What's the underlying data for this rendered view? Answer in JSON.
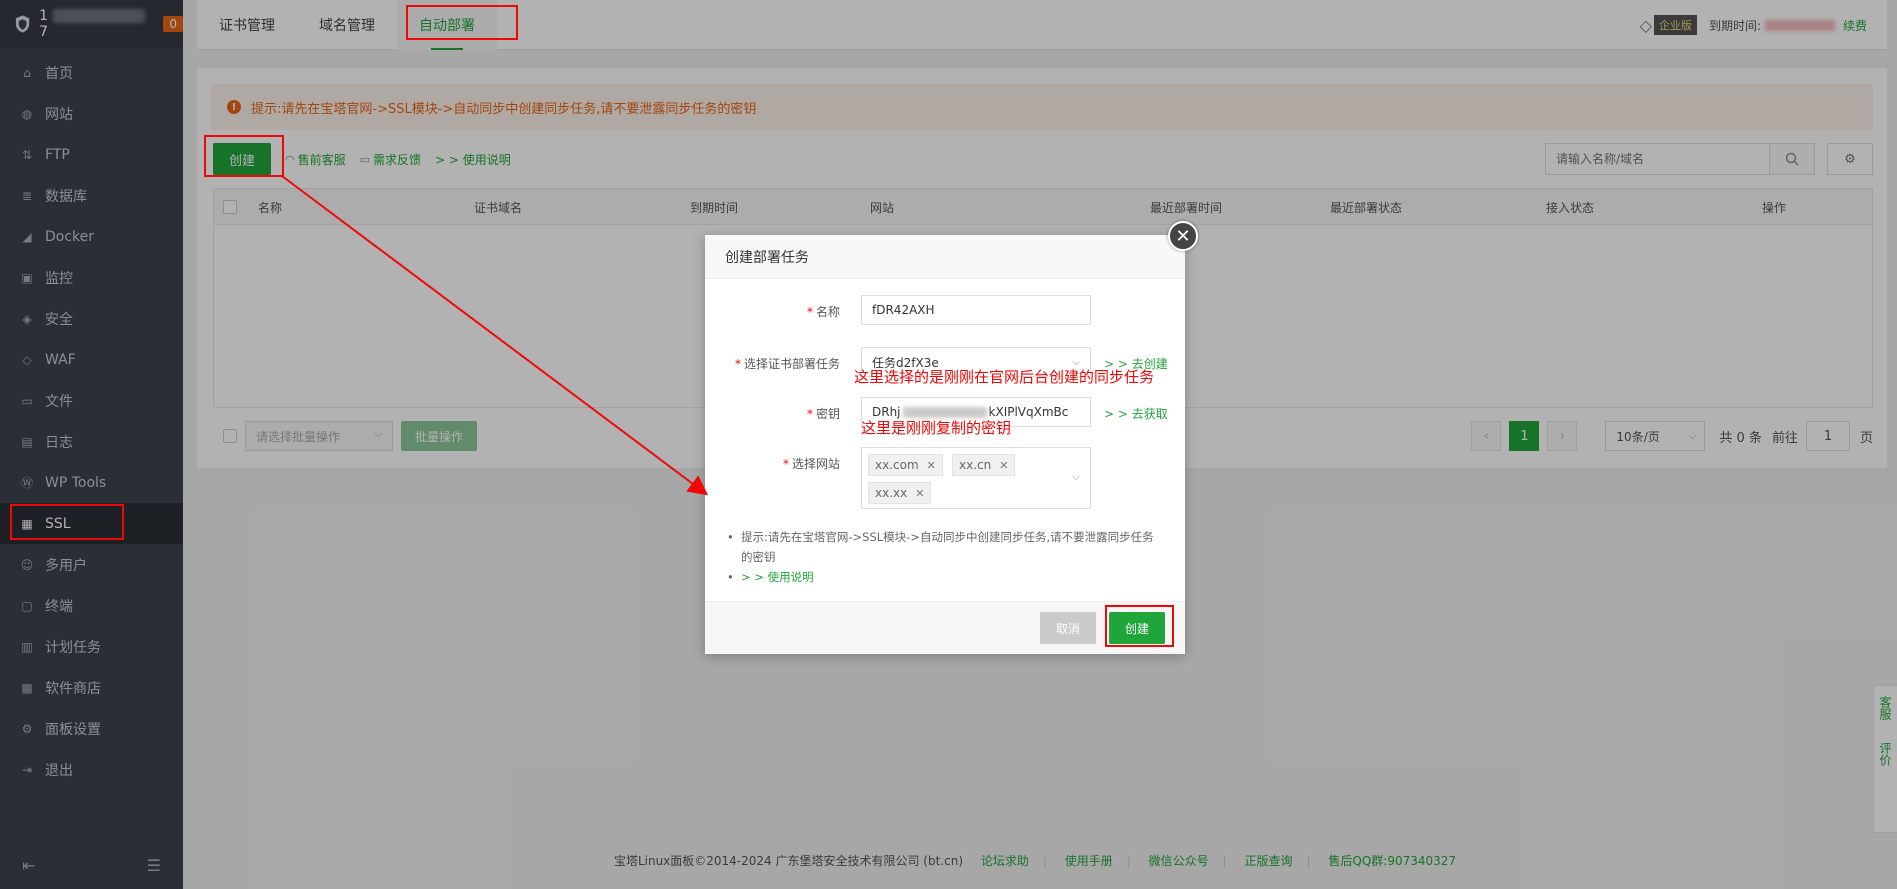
{
  "sidebar": {
    "ip_prefix": "1",
    "ip_suffix": "7",
    "badge": "0",
    "items": [
      {
        "label": "首页",
        "icon": "home-icon",
        "glyph": "⌂"
      },
      {
        "label": "网站",
        "icon": "globe-icon",
        "glyph": "◍"
      },
      {
        "label": "FTP",
        "icon": "ftp-icon",
        "glyph": "⇅"
      },
      {
        "label": "数据库",
        "icon": "database-icon",
        "glyph": "≣"
      },
      {
        "label": "Docker",
        "icon": "docker-icon",
        "glyph": "◢"
      },
      {
        "label": "监控",
        "icon": "monitor-icon",
        "glyph": "▣"
      },
      {
        "label": "安全",
        "icon": "shield-icon",
        "glyph": "◈"
      },
      {
        "label": "WAF",
        "icon": "waf-icon",
        "glyph": "◇"
      },
      {
        "label": "文件",
        "icon": "folder-icon",
        "glyph": "▭"
      },
      {
        "label": "日志",
        "icon": "log-icon",
        "glyph": "▤"
      },
      {
        "label": "WP Tools",
        "icon": "wordpress-icon",
        "glyph": "Ⓦ"
      },
      {
        "label": "SSL",
        "icon": "ssl-icon",
        "glyph": "▦"
      },
      {
        "label": "多用户",
        "icon": "users-icon",
        "glyph": "☺"
      },
      {
        "label": "终端",
        "icon": "terminal-icon",
        "glyph": "▢"
      },
      {
        "label": "计划任务",
        "icon": "calendar-icon",
        "glyph": "▥"
      },
      {
        "label": "软件商店",
        "icon": "apps-icon",
        "glyph": "▩"
      },
      {
        "label": "面板设置",
        "icon": "gear-icon",
        "glyph": "⚙"
      },
      {
        "label": "退出",
        "icon": "logout-icon",
        "glyph": "⇥"
      }
    ]
  },
  "tabs": [
    {
      "label": "证书管理"
    },
    {
      "label": "域名管理"
    },
    {
      "label": "自动部署"
    }
  ],
  "topright": {
    "edition": "企业版",
    "expire_label": "到期时间:",
    "renew": "续费"
  },
  "alert": {
    "text": "提示:请先在宝塔官网->SSL模块->自动同步中创建同步任务,请不要泄露同步任务的密钥"
  },
  "toolbar": {
    "create": "创建",
    "presale": "售前客服",
    "feedback": "需求反馈",
    "usage": "> > 使用说明",
    "search_placeholder": "请输入名称/域名"
  },
  "table": {
    "columns": [
      "名称",
      "证书域名",
      "到期时间",
      "网站",
      "最近部署时间",
      "最近部署状态",
      "接入状态",
      "操作"
    ]
  },
  "batch": {
    "select_placeholder": "请选择批量操作",
    "button": "批量操作"
  },
  "pager": {
    "current": "1",
    "page_size": "10条/页",
    "total": "共 0 条",
    "goto_label": "前往",
    "goto_value": "1",
    "page_suffix": "页"
  },
  "footer": {
    "copyright": "宝塔Linux面板©2014-2024 广东堡塔安全技术有限公司 (bt.cn)",
    "links": [
      "论坛求助",
      "使用手册",
      "微信公众号",
      "正版查询"
    ],
    "qq": "售后QQ群:907340327"
  },
  "side_float": {
    "service": "客服",
    "review": "评价"
  },
  "dialog": {
    "title": "创建部署任务",
    "name_label": "名称",
    "name_value": "fDR42AXH",
    "task_label": "选择证书部署任务",
    "task_value": "任务d2fX3e",
    "task_side": "> > 去创建",
    "key_label": "密钥",
    "key_prefix": "DRhj",
    "key_suffix": "kXIPlVqXmBc",
    "key_side": "> > 去获取",
    "site_label": "选择网站",
    "sites": [
      "xx.com",
      "xx.cn",
      "xx.xx"
    ],
    "tip1": "提示:请先在宝塔官网->SSL模块->自动同步中创建同步任务,请不要泄露同步任务的密钥",
    "tip2": "> > 使用说明",
    "cancel": "取消",
    "create": "创建"
  },
  "annotations": {
    "task_note": "这里选择的是刚刚在官网后台创建的同步任务",
    "key_note": "这里是刚刚复制的密钥",
    "color": "#ef0808"
  },
  "colors": {
    "accent": "#20a53a",
    "sidebar_bg": "#3c444d",
    "alert": "#e96617"
  }
}
